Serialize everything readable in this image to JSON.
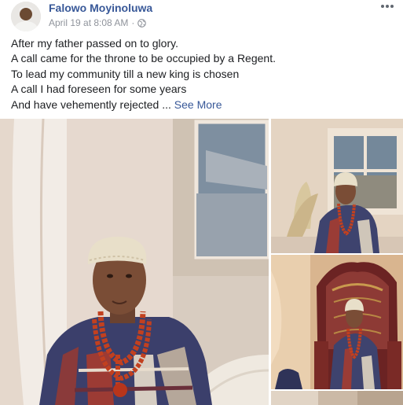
{
  "post": {
    "author_name": "Falowo Moyinoluwa",
    "date": "April 19 at 8:08 AM",
    "separator": "·",
    "privacy_icon": "globe-icon",
    "more_icon": "more-options-icon",
    "text_lines": [
      "After my father passed on to glory.",
      "A call came for the throne to be occupied by a Regent.",
      "To lead my community till a new king is chosen",
      "A call I had foreseen for some years",
      "And have vehemently rejected ..."
    ],
    "see_more": "See More"
  },
  "colors": {
    "link": "#385898",
    "meta": "#90949c",
    "text": "#1c1e21",
    "beads": "#c2401f",
    "crown": "#e8dfc9"
  }
}
